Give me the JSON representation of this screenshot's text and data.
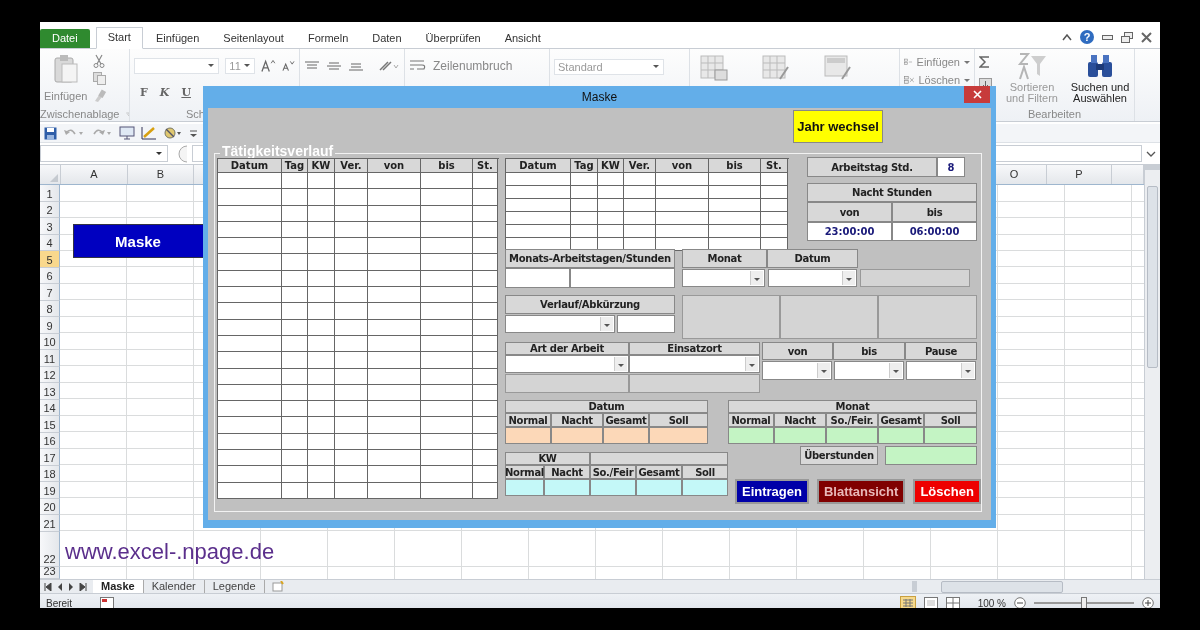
{
  "ribbon_tabs": [
    {
      "label": "Datei",
      "kind": "file",
      "selected": false
    },
    {
      "label": "Start",
      "kind": "tab",
      "selected": true
    },
    {
      "label": "Einfügen",
      "kind": "tab",
      "selected": false
    },
    {
      "label": "Seitenlayout",
      "kind": "tab",
      "selected": false
    },
    {
      "label": "Formeln",
      "kind": "tab",
      "selected": false
    },
    {
      "label": "Daten",
      "kind": "tab",
      "selected": false
    },
    {
      "label": "Überprüfen",
      "kind": "tab",
      "selected": false
    },
    {
      "label": "Ansicht",
      "kind": "tab",
      "selected": false
    }
  ],
  "help": "?",
  "ribbon": {
    "paste": "Einfügen",
    "clipboard_group": "Zwischenablage",
    "font_size": "11",
    "bold": "F",
    "italic": "K",
    "underline": "U",
    "font_group": "Sch",
    "wrap": "Zeilenumbruch",
    "number_format": "Standard",
    "cells_insert": "Einfügen",
    "cells_delete": "Löschen",
    "sort": {
      "label": "Sortieren und Filtern",
      "disabled": true
    },
    "find": {
      "label": "Suchen und Auswählen",
      "disabled": false
    },
    "editing_group": "Bearbeiten"
  },
  "sheet": {
    "columns": [
      {
        "label": "A",
        "selected": false
      },
      {
        "label": "B",
        "selected": false
      },
      {
        "label": "O",
        "selected": false
      },
      {
        "label": "P",
        "selected": false
      }
    ],
    "rows": [
      {
        "label": "1",
        "selected": false
      },
      {
        "label": "2",
        "selected": false
      },
      {
        "label": "3",
        "selected": false
      },
      {
        "label": "4",
        "selected": false
      },
      {
        "label": "5",
        "selected": true
      },
      {
        "label": "6",
        "selected": false
      },
      {
        "label": "7",
        "selected": false
      },
      {
        "label": "8",
        "selected": false
      },
      {
        "label": "9",
        "selected": false
      },
      {
        "label": "10",
        "selected": false
      },
      {
        "label": "11",
        "selected": false
      },
      {
        "label": "12",
        "selected": false
      },
      {
        "label": "13",
        "selected": false
      },
      {
        "label": "14",
        "selected": false
      },
      {
        "label": "15",
        "selected": false
      },
      {
        "label": "16",
        "selected": false
      },
      {
        "label": "17",
        "selected": false
      },
      {
        "label": "18",
        "selected": false
      },
      {
        "label": "19",
        "selected": false
      },
      {
        "label": "20",
        "selected": false
      },
      {
        "label": "21",
        "selected": false
      },
      {
        "label": "22",
        "selected": false
      },
      {
        "label": "23",
        "selected": false
      }
    ],
    "button": "Maske",
    "link": "www.excel-.npage.de"
  },
  "sheet_tabs": [
    {
      "label": "Maske",
      "selected": true
    },
    {
      "label": "Kalender",
      "selected": false
    },
    {
      "label": "Legende",
      "selected": false
    }
  ],
  "status_bar": {
    "text": "Bereit",
    "zoom": "100 %",
    "zoom_level": {
      "level": 0.5
    }
  },
  "dialog": {
    "title": "Maske",
    "year_button": "Jahr wechsel",
    "frame_label": "Tätigkeitsverlauf",
    "log_columns": [
      "Datum",
      "Tag",
      "KW",
      "Ver.",
      "von",
      "bis",
      "St."
    ],
    "log_columns_right": [
      "Datum",
      "Tag",
      "KW",
      "Ver.",
      "von",
      "bis",
      "St."
    ],
    "workday_label": "Arbeitstag Std.",
    "workday_value": "8",
    "night": {
      "title": "Nacht Stunden",
      "from_label": "von",
      "to_label": "bis",
      "from": "23:00:00",
      "to": "06:00:00"
    },
    "monthly_label": "Monats-Arbeitstagen/Stunden",
    "month_label": "Monat",
    "date_label": "Datum",
    "history_label": "Verlauf/Abkürzung",
    "work_type_label": "Art der Arbeit",
    "location_label": "Einsatzort",
    "from_label": "von",
    "to_label": "bis",
    "break_label": "Pause",
    "day_totals": {
      "title": "Datum",
      "columns": [
        "Normal",
        "Nacht",
        "Gesamt",
        "Soll"
      ]
    },
    "month_totals": {
      "title": "Monat",
      "columns": [
        "Normal",
        "Nacht",
        "So./Feir.",
        "Gesamt",
        "Soll"
      ]
    },
    "overtime_label": "Überstunden",
    "week_totals": {
      "title": "KW",
      "columns": [
        "Normal",
        "Nacht",
        "So./Feir",
        "Gesamt",
        "Soll"
      ]
    },
    "buttons": [
      {
        "label": "Eintragen",
        "kind": "enter"
      },
      {
        "label": "Blattansicht",
        "kind": "sheet"
      },
      {
        "label": "Löschen",
        "kind": "delete"
      }
    ]
  }
}
